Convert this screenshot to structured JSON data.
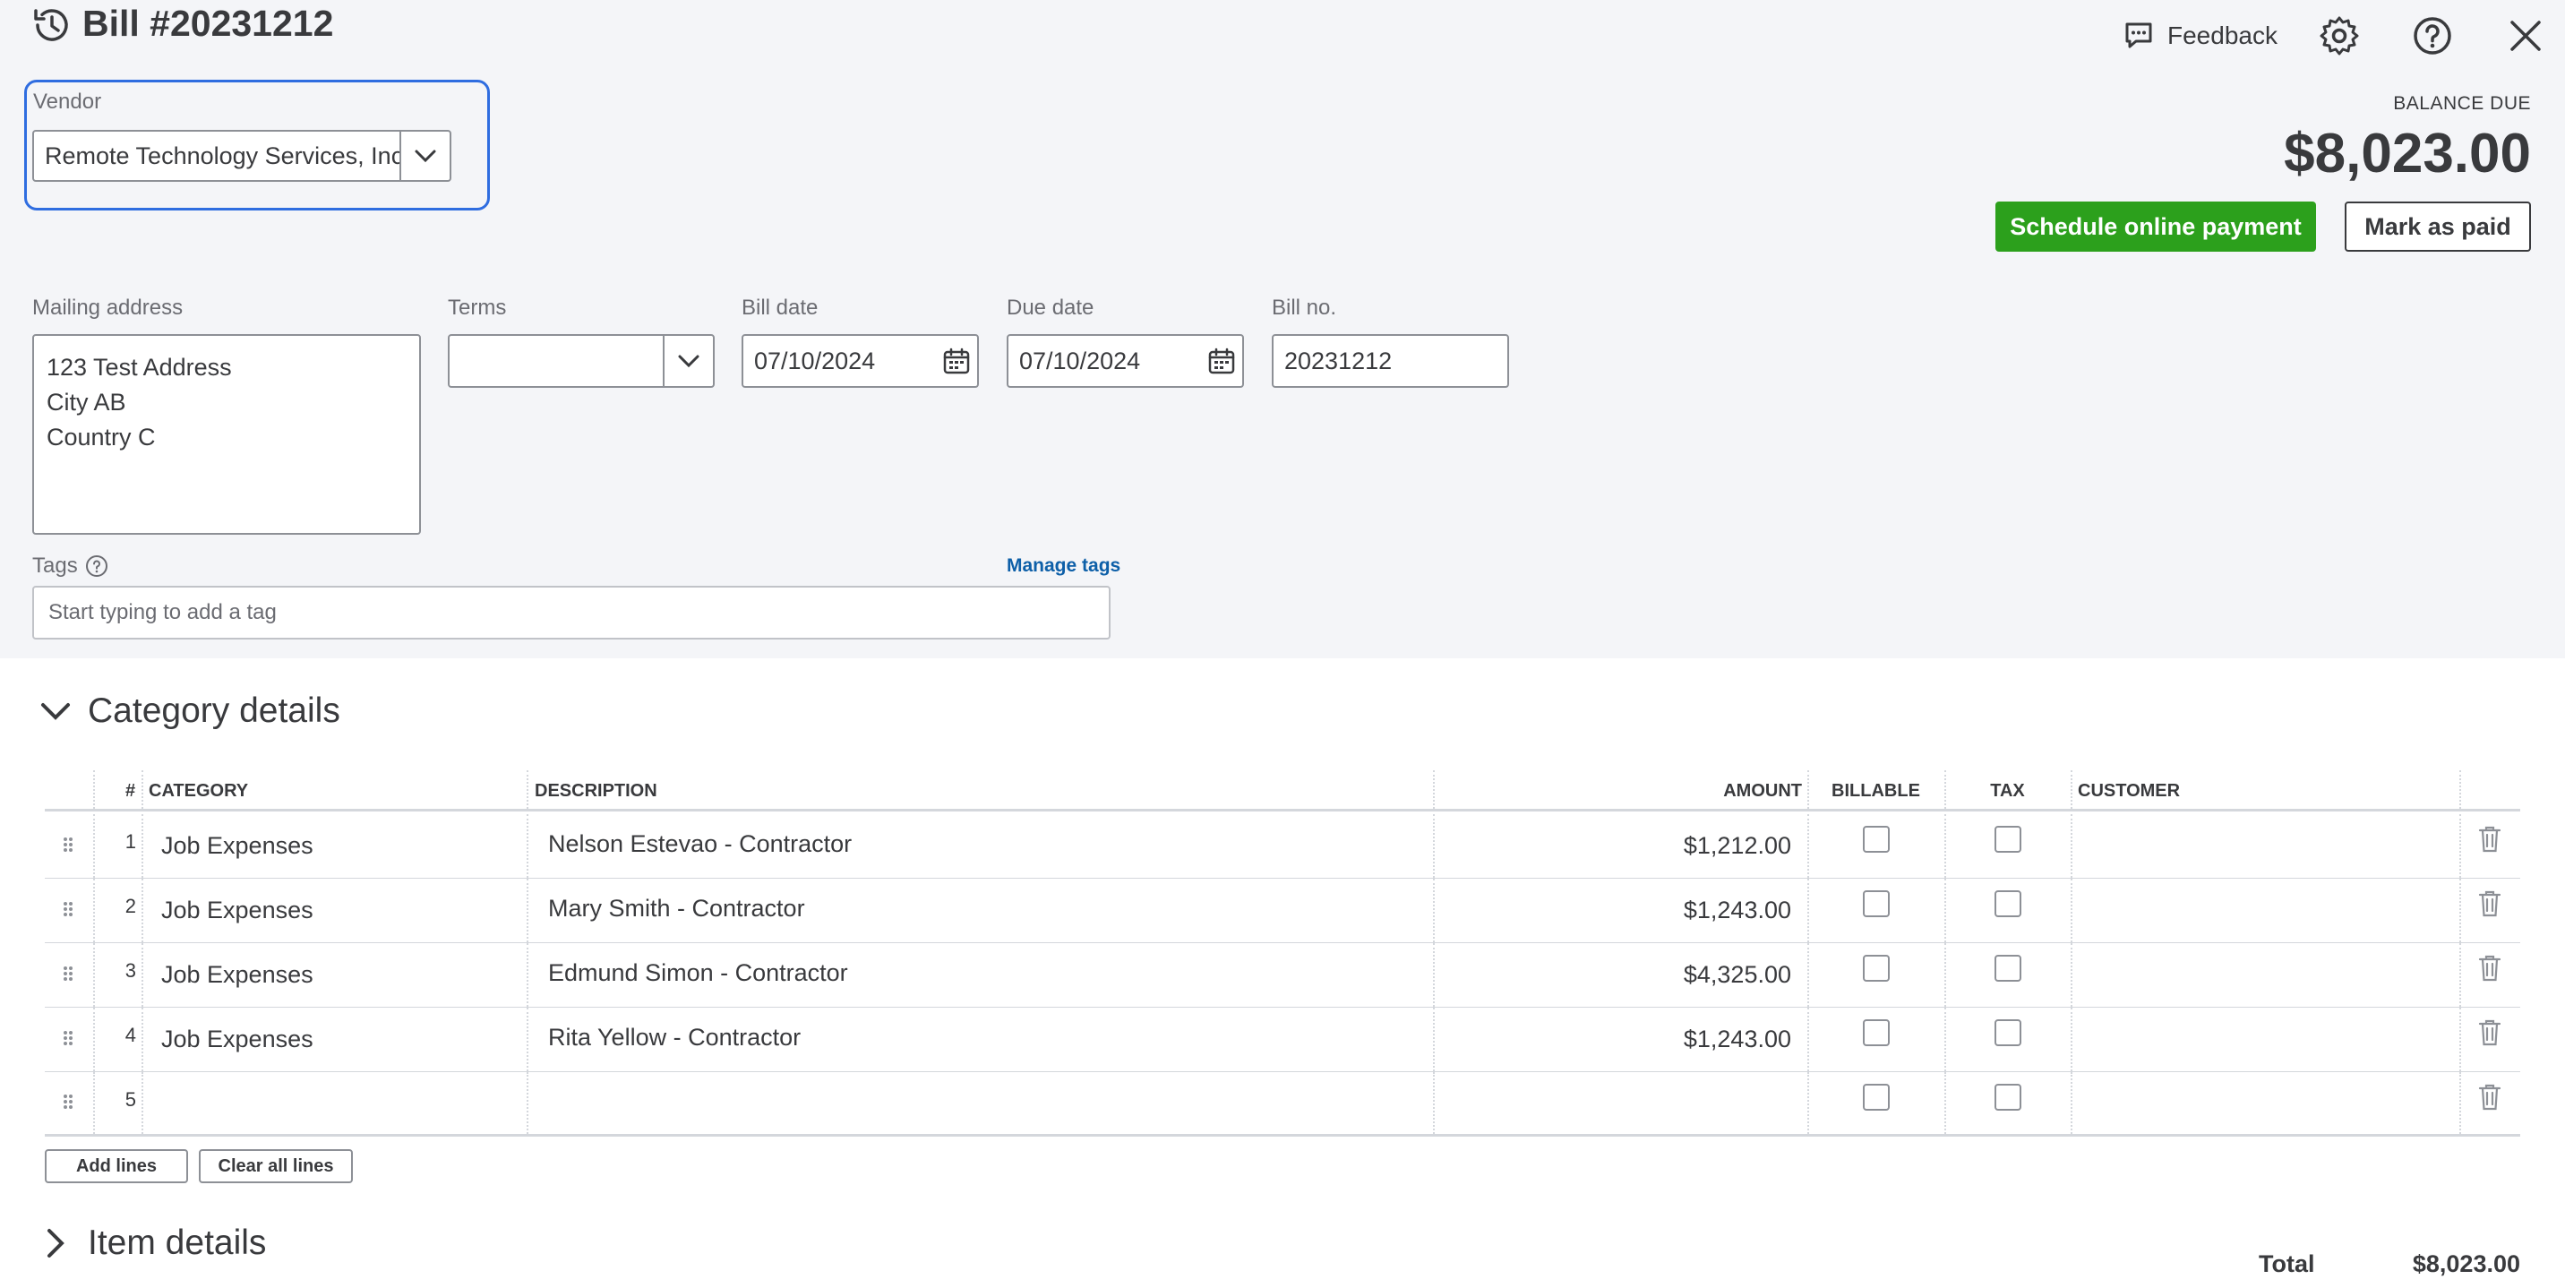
{
  "header": {
    "title": "Bill #20231212",
    "feedback_label": "Feedback",
    "icons": [
      "history-icon",
      "feedback-icon",
      "gear-icon",
      "help-icon",
      "close-icon"
    ]
  },
  "vendor": {
    "label": "Vendor",
    "value": "Remote Technology Services, Inc."
  },
  "balance": {
    "label": "BALANCE DUE",
    "amount": "$8,023.00",
    "schedule_label": "Schedule online payment",
    "mark_paid_label": "Mark as paid"
  },
  "form": {
    "mailing_label": "Mailing address",
    "address_lines": [
      "123 Test Address",
      "City AB",
      "Country C"
    ],
    "terms_label": "Terms",
    "terms_value": "",
    "bill_date_label": "Bill date",
    "bill_date": "07/10/2024",
    "due_date_label": "Due date",
    "due_date": "07/10/2024",
    "bill_no_label": "Bill no.",
    "bill_no": "20231212",
    "tags_label": "Tags",
    "tags_placeholder": "Start typing to add a tag",
    "manage_tags": "Manage tags"
  },
  "category": {
    "title": "Category details",
    "columns": {
      "num": "#",
      "category": "CATEGORY",
      "description": "DESCRIPTION",
      "amount": "AMOUNT",
      "billable": "BILLABLE",
      "tax": "TAX",
      "customer": "CUSTOMER"
    },
    "rows": [
      {
        "num": "1",
        "category": "Job Expenses",
        "description": "Nelson Estevao - Contractor",
        "amount": "$1,212.00"
      },
      {
        "num": "2",
        "category": "Job Expenses",
        "description": "Mary Smith - Contractor",
        "amount": "$1,243.00"
      },
      {
        "num": "3",
        "category": "Job Expenses",
        "description": "Edmund Simon - Contractor",
        "amount": "$4,325.00"
      },
      {
        "num": "4",
        "category": "Job Expenses",
        "description": "Rita Yellow - Contractor",
        "amount": "$1,243.00"
      },
      {
        "num": "5",
        "category": "",
        "description": "",
        "amount": ""
      }
    ],
    "add_lines": "Add lines",
    "clear_lines": "Clear all lines"
  },
  "item": {
    "title": "Item details"
  },
  "total": {
    "label": "Total",
    "value": "$8,023.00"
  },
  "colors": {
    "accent_blue": "#2f6de0",
    "primary_green": "#2ca01c",
    "link_blue": "#0d5fa8",
    "panel_bg": "#f4f5f8"
  }
}
